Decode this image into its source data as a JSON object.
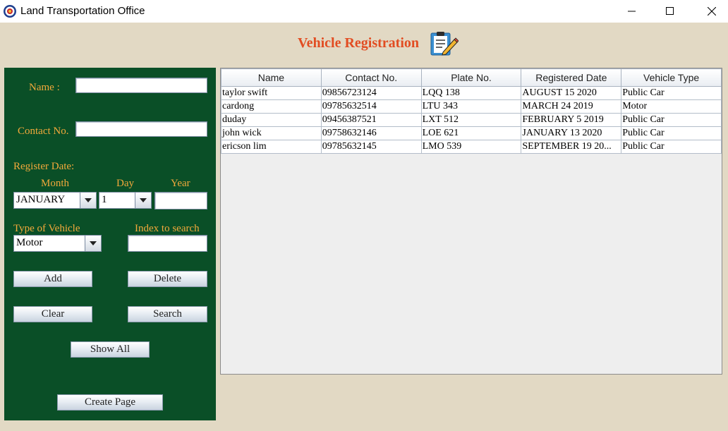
{
  "window": {
    "title": "Land Transportation Office",
    "controls": [
      "minimize-icon",
      "maximize-icon",
      "close-icon"
    ]
  },
  "heading": {
    "text": "Vehicle Registration",
    "icon": "clipboard-pencil-icon"
  },
  "form": {
    "name_label": "Name :",
    "name_value": "",
    "contact_label": "Contact No.",
    "contact_value": "",
    "register_date_label": "Register Date:",
    "month_label": "Month",
    "day_label": "Day",
    "year_label": "Year",
    "month_value": "JANUARY",
    "day_value": "1",
    "year_value": "",
    "type_label": "Type of Vehicle",
    "type_value": "Motor",
    "index_label": "Index to search",
    "index_value": ""
  },
  "buttons": {
    "add": "Add",
    "delete": "Delete",
    "clear": "Clear",
    "search": "Search",
    "show_all": "Show All",
    "create_page": "Create Page"
  },
  "table": {
    "columns": [
      "Name",
      "Contact No.",
      "Plate No.",
      "Registered Date",
      "Vehicle Type"
    ],
    "rows": [
      [
        "taylor swift",
        "09856723124",
        "LQQ 138",
        "AUGUST 15 2020",
        "Public Car"
      ],
      [
        "cardong",
        "09785632514",
        "LTU 343",
        "MARCH 24 2019",
        "Motor"
      ],
      [
        "duday",
        "09456387521",
        "LXT 512",
        "FEBRUARY 5 2019",
        "Public Car"
      ],
      [
        "john wick",
        "09758632146",
        "LOE 621",
        "JANUARY 13 2020",
        "Public Car"
      ],
      [
        "ericson lim",
        "09785632145",
        "LMO 539",
        "SEPTEMBER 19 20...",
        "Public Car"
      ]
    ]
  },
  "colors": {
    "background": "#e2d9c4",
    "panel": "#0a4f27",
    "label": "#f2a93b",
    "heading": "#e24d22"
  }
}
